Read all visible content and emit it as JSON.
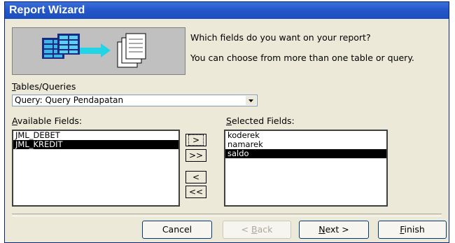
{
  "window": {
    "title": "Report Wizard"
  },
  "intro": {
    "question": "Which fields do you want on your report?",
    "hint": "You can choose from more than one table or query."
  },
  "tables_queries": {
    "label_accel": "T",
    "label_rest": "ables/Queries",
    "selected": "Query: Query Pendapatan"
  },
  "available": {
    "label_accel": "A",
    "label_rest": "vailable Fields:",
    "items": [
      "JML_DEBET",
      "JML_KREDIT"
    ],
    "selected_index": 1
  },
  "selected": {
    "label_accel": "S",
    "label_rest": "elected Fields:",
    "items": [
      "koderek",
      "namarek",
      "saldo"
    ],
    "selected_index": 2
  },
  "move_buttons": {
    "add_one": ">",
    "add_all": ">>",
    "remove_one": "<",
    "remove_all": "<<"
  },
  "buttons": {
    "cancel": "Cancel",
    "back_accel": "B",
    "back_pre": "< ",
    "back_rest": "ack",
    "next_accel": "N",
    "next_rest": "ext >",
    "finish_accel": "F",
    "finish_rest": "inish"
  },
  "colors": {
    "titlebar": "#2458c9",
    "selection": "#000000",
    "dialog_bg": "#ece9d8"
  }
}
